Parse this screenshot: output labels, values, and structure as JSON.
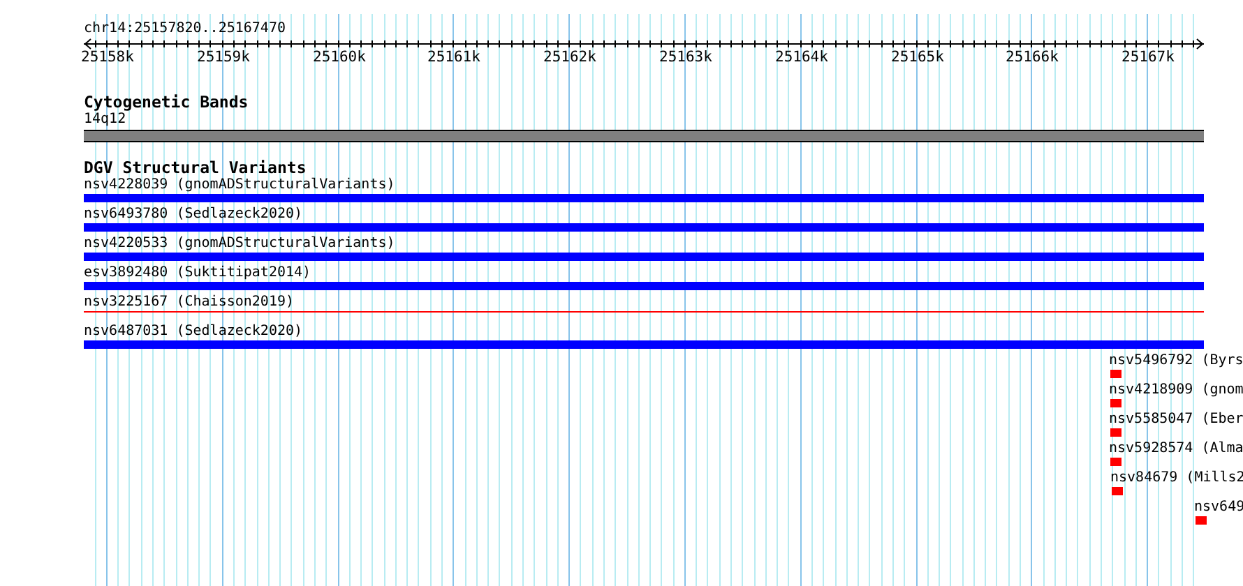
{
  "ruler": {
    "location": "chr14:25157820..25167470",
    "ticks": [
      "25158k",
      "25159k",
      "25160k",
      "25161k",
      "25162k",
      "25163k",
      "25164k",
      "25165k",
      "25166k",
      "25167k"
    ]
  },
  "tracks": [
    {
      "title": "Cytogenetic Bands",
      "features": [
        {
          "label": "14q12",
          "kind": "band",
          "color": "#808080"
        }
      ]
    },
    {
      "title": "DGV Structural Variants",
      "features": [
        {
          "label": "nsv4228039 (gnomADStructuralVariants)",
          "kind": "bar",
          "color": "#0000ff"
        },
        {
          "label": "nsv6493780 (Sedlazeck2020)",
          "kind": "bar",
          "color": "#0000ff"
        },
        {
          "label": "nsv4220533 (gnomADStructuralVariants)",
          "kind": "bar",
          "color": "#0000ff"
        },
        {
          "label": "esv3892480 (Suktitipat2014)",
          "kind": "bar",
          "color": "#0000ff"
        },
        {
          "label": "nsv3225167 (Chaisson2019)",
          "kind": "line",
          "color": "#ff0000"
        },
        {
          "label": "nsv6487031 (Sedlazeck2020)",
          "kind": "bar",
          "color": "#0000ff"
        },
        {
          "label": "nsv5496792 (Byrs",
          "kind": "box",
          "color": "#ff0000"
        },
        {
          "label": "nsv4218909 (gnom",
          "kind": "box",
          "color": "#ff0000"
        },
        {
          "label": "nsv5585047 (Eber",
          "kind": "box",
          "color": "#ff0000"
        },
        {
          "label": "nsv5928574 (Alma",
          "kind": "box",
          "color": "#ff0000"
        },
        {
          "label": "nsv84679 (Mills2",
          "kind": "box",
          "color": "#ff0000"
        },
        {
          "label": "nsv649",
          "kind": "box",
          "color": "#ff0000"
        }
      ]
    }
  ]
}
